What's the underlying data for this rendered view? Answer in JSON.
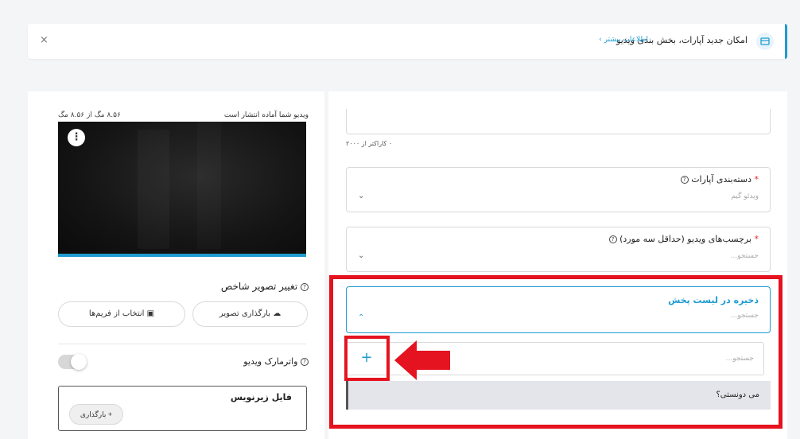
{
  "banner": {
    "text": "امکان جدید آپارات، بخش بندی ویدیو",
    "link": "اطلاعات بیشتر ›",
    "icon": "video-icon",
    "close": "×",
    "accent_color": "#1f9bd1"
  },
  "video_panel": {
    "status": "ویدیو شما آماده انتشار است",
    "size": "۸.۵۶ مگ از ۸.۵۶ مگ",
    "menu_icon": "⋮",
    "progress": 1.0
  },
  "thumbnail": {
    "title": "تغییر تصویر شاخص",
    "upload_button": "بارگذاری تصویر",
    "frames_button": "انتخاب از فریم‌ها"
  },
  "watermark": {
    "label": "واترمارک ویدیو",
    "enabled": false
  },
  "subtitle": {
    "title": "فایل زیرنویس",
    "upload_button": "بارگذاری"
  },
  "form": {
    "char_count": "۰ کاراکتر از ۲۰۰۰",
    "category": {
      "label": "دسته‌بندی آپارات",
      "required": "*",
      "value": "ویدئو گیم"
    },
    "tags": {
      "label": "برچسب‌های ویدیو (حداقل سه مورد)",
      "required": "*",
      "placeholder": "جستجو..."
    },
    "playlist": {
      "label": "ذخیره در لیست پخش",
      "placeholder": "جستجو...",
      "search_placeholder": "جستجو...",
      "add_symbol": "+",
      "items": [
        "می دونستی؟"
      ]
    },
    "help_symbol": "?"
  },
  "colors": {
    "accent": "#1f9bd1",
    "annotation_red": "#e5121f"
  }
}
